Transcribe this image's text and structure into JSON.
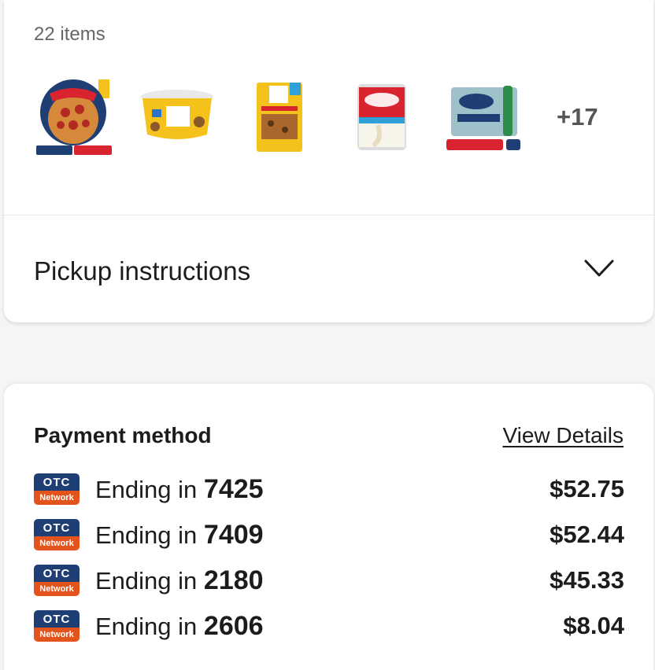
{
  "order": {
    "items_count": "22 items",
    "products": [
      {
        "name": "Jack's Original Thin Crust Pepperoni pizza",
        "icon": "pizza-box"
      },
      {
        "name": "Nestle Toll House cookie dough tub",
        "icon": "cookie-dough-tub"
      },
      {
        "name": "Nestle Toll House chocolate chip cookie dough",
        "icon": "cookie-dough-pack"
      },
      {
        "name": "Carnation evaporated milk can",
        "icon": "milk-can"
      },
      {
        "name": "S.Pellegrino sparkling mineral water 12 pack",
        "icon": "water-pack"
      }
    ],
    "more_count": "+17"
  },
  "pickup": {
    "label": "Pickup instructions"
  },
  "payment": {
    "title": "Payment method",
    "view_details": "View Details",
    "badge": {
      "top": "OTC",
      "bottom": "Network"
    },
    "ending_prefix": "Ending in",
    "methods": [
      {
        "last4": "7425",
        "amount": "$52.75"
      },
      {
        "last4": "7409",
        "amount": "$52.44"
      },
      {
        "last4": "2180",
        "amount": "$45.33"
      },
      {
        "last4": "2606",
        "amount": "$8.04"
      }
    ]
  },
  "colors": {
    "otc_blue": "#1f3e74",
    "otc_orange": "#e3541c",
    "jacks_red": "#d9232e",
    "tollhouse_yellow": "#f4c21b"
  }
}
